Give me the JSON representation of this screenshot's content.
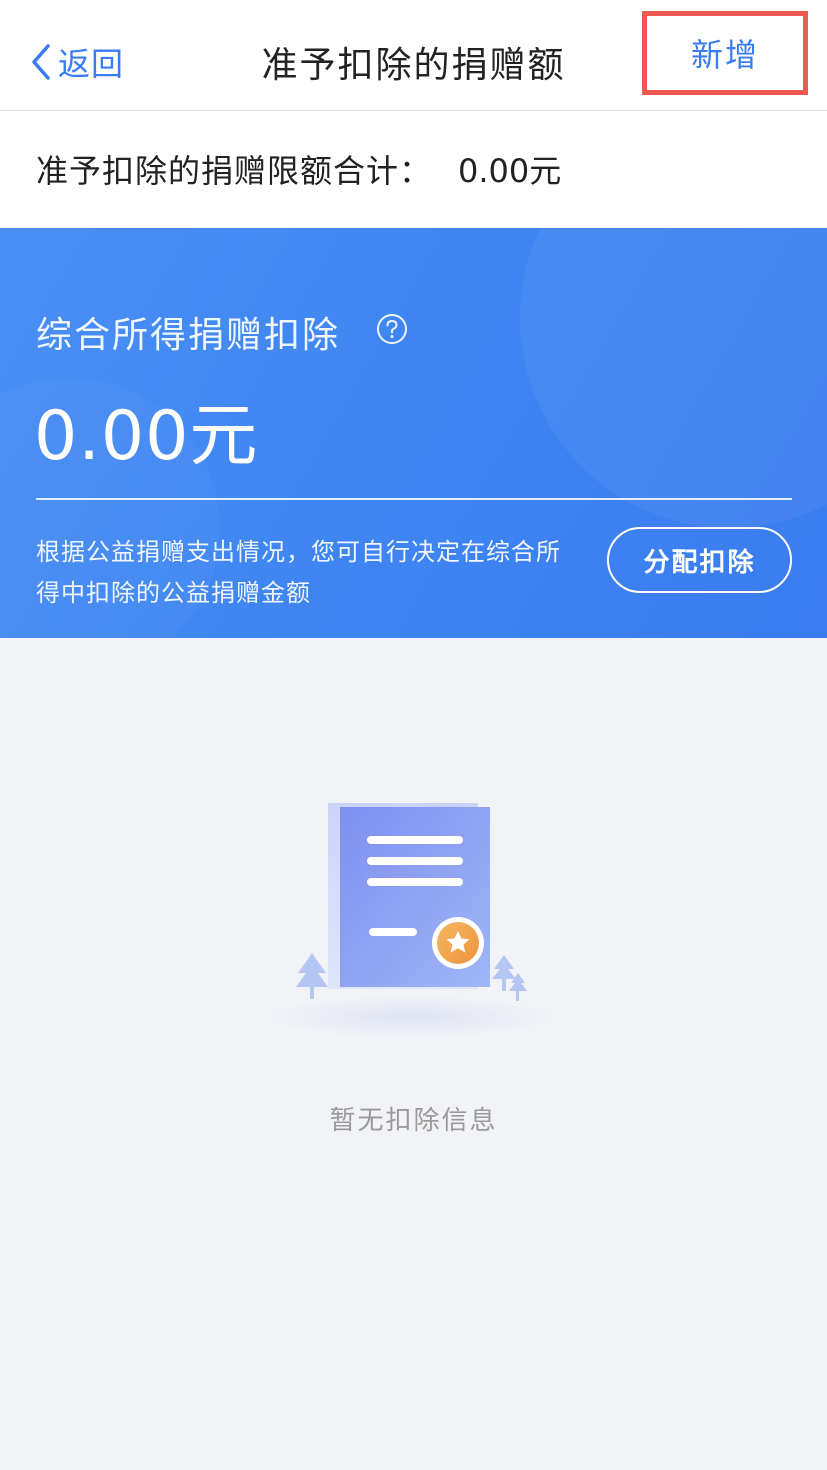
{
  "nav": {
    "back_label": "返回",
    "title": "准予扣除的捐赠额",
    "add_label": "新增"
  },
  "summary": {
    "total_label": "准予扣除的捐赠限额合计：",
    "total_value": "0.00元"
  },
  "card": {
    "title": "综合所得捐赠扣除",
    "help_icon": "question-circle-icon",
    "amount": "0.00元",
    "description": "根据公益捐赠支出情况，您可自行决定在综合所得中扣除的公益捐赠金额",
    "allocate_label": "分配扣除"
  },
  "empty_state": {
    "icon": "document-certificate-icon",
    "message": "暂无扣除信息"
  },
  "colors": {
    "accent": "#3a7bf6",
    "card_gradient_start": "#4a8ff5",
    "card_gradient_end": "#3a7cf0",
    "highlight_border": "#ee5a52",
    "badge_orange": "#f0a24a"
  }
}
